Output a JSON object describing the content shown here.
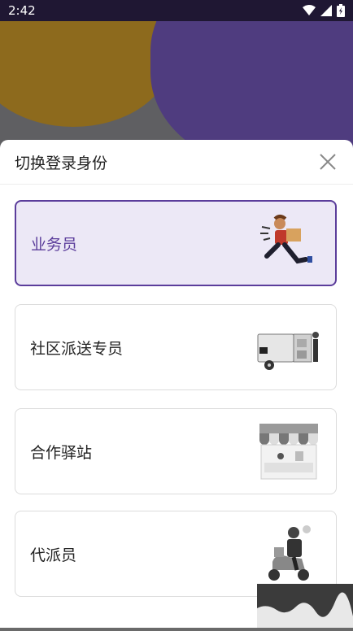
{
  "status": {
    "time": "2:42"
  },
  "sheet": {
    "title": "切换登录身份"
  },
  "roles": [
    {
      "label": "业务员",
      "selected": true
    },
    {
      "label": "社区派送专员",
      "selected": false
    },
    {
      "label": "合作驿站",
      "selected": false
    },
    {
      "label": "代派员",
      "selected": false
    }
  ],
  "colors": {
    "accent": "#5b3d9b",
    "selected_bg": "#ece8f6"
  }
}
